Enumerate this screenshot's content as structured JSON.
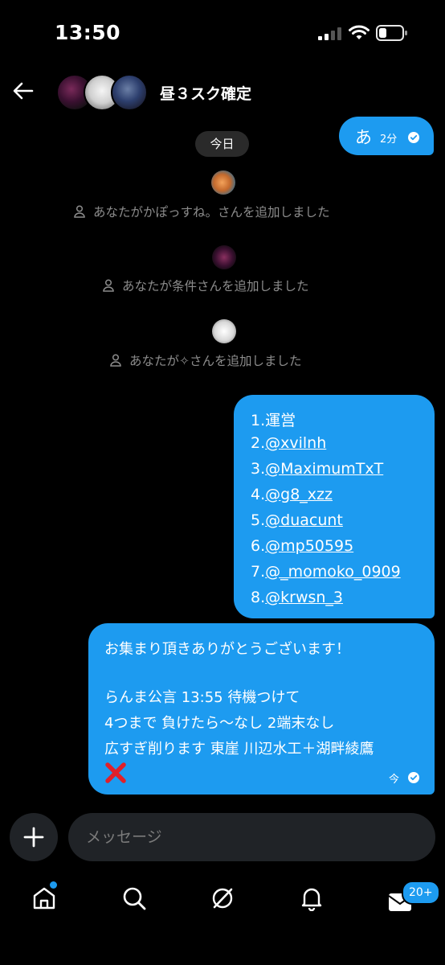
{
  "status_bar": {
    "time": "13:50"
  },
  "header": {
    "title": "昼３スク確定"
  },
  "chat": {
    "first_message": {
      "text": "あ",
      "time": "2分"
    },
    "date_separator": "今日",
    "system_events": [
      {
        "text": "あなたがかぽっすね。さんを追加しました"
      },
      {
        "text": "あなたが条件さんを追加しました"
      },
      {
        "text": "あなたが✧さんを追加しました"
      }
    ],
    "list_message": {
      "lines": [
        {
          "num": "1.",
          "text": "運営"
        },
        {
          "num": "2.",
          "text": "@xvilnh"
        },
        {
          "num": "3.",
          "text": "@MaximumTxT"
        },
        {
          "num": "4.",
          "text": "@g8_xzz"
        },
        {
          "num": "5.",
          "text": "@duacunt"
        },
        {
          "num": "6.",
          "text": "@mp50595"
        },
        {
          "num": "7.",
          "text": "@_momoko_0909"
        },
        {
          "num": "8.",
          "text": "@krwsn_3"
        }
      ]
    },
    "last_message": {
      "lines": [
        "お集まり頂きありがとうございます！",
        "らんま公言 13:55 待機つけて",
        "4つまで 負けたら〜なし 2端末なし",
        "広すぎ削ります 東崖 川辺水工＋湖畔綾鷹"
      ],
      "time": "今"
    }
  },
  "composer": {
    "placeholder": "メッセージ"
  },
  "bottom_nav": {
    "messages_badge": "20+"
  },
  "colors": {
    "accent": "#1d9bf0",
    "background": "#000000",
    "input_bg": "#202327",
    "system_text": "#8c8c8c"
  }
}
